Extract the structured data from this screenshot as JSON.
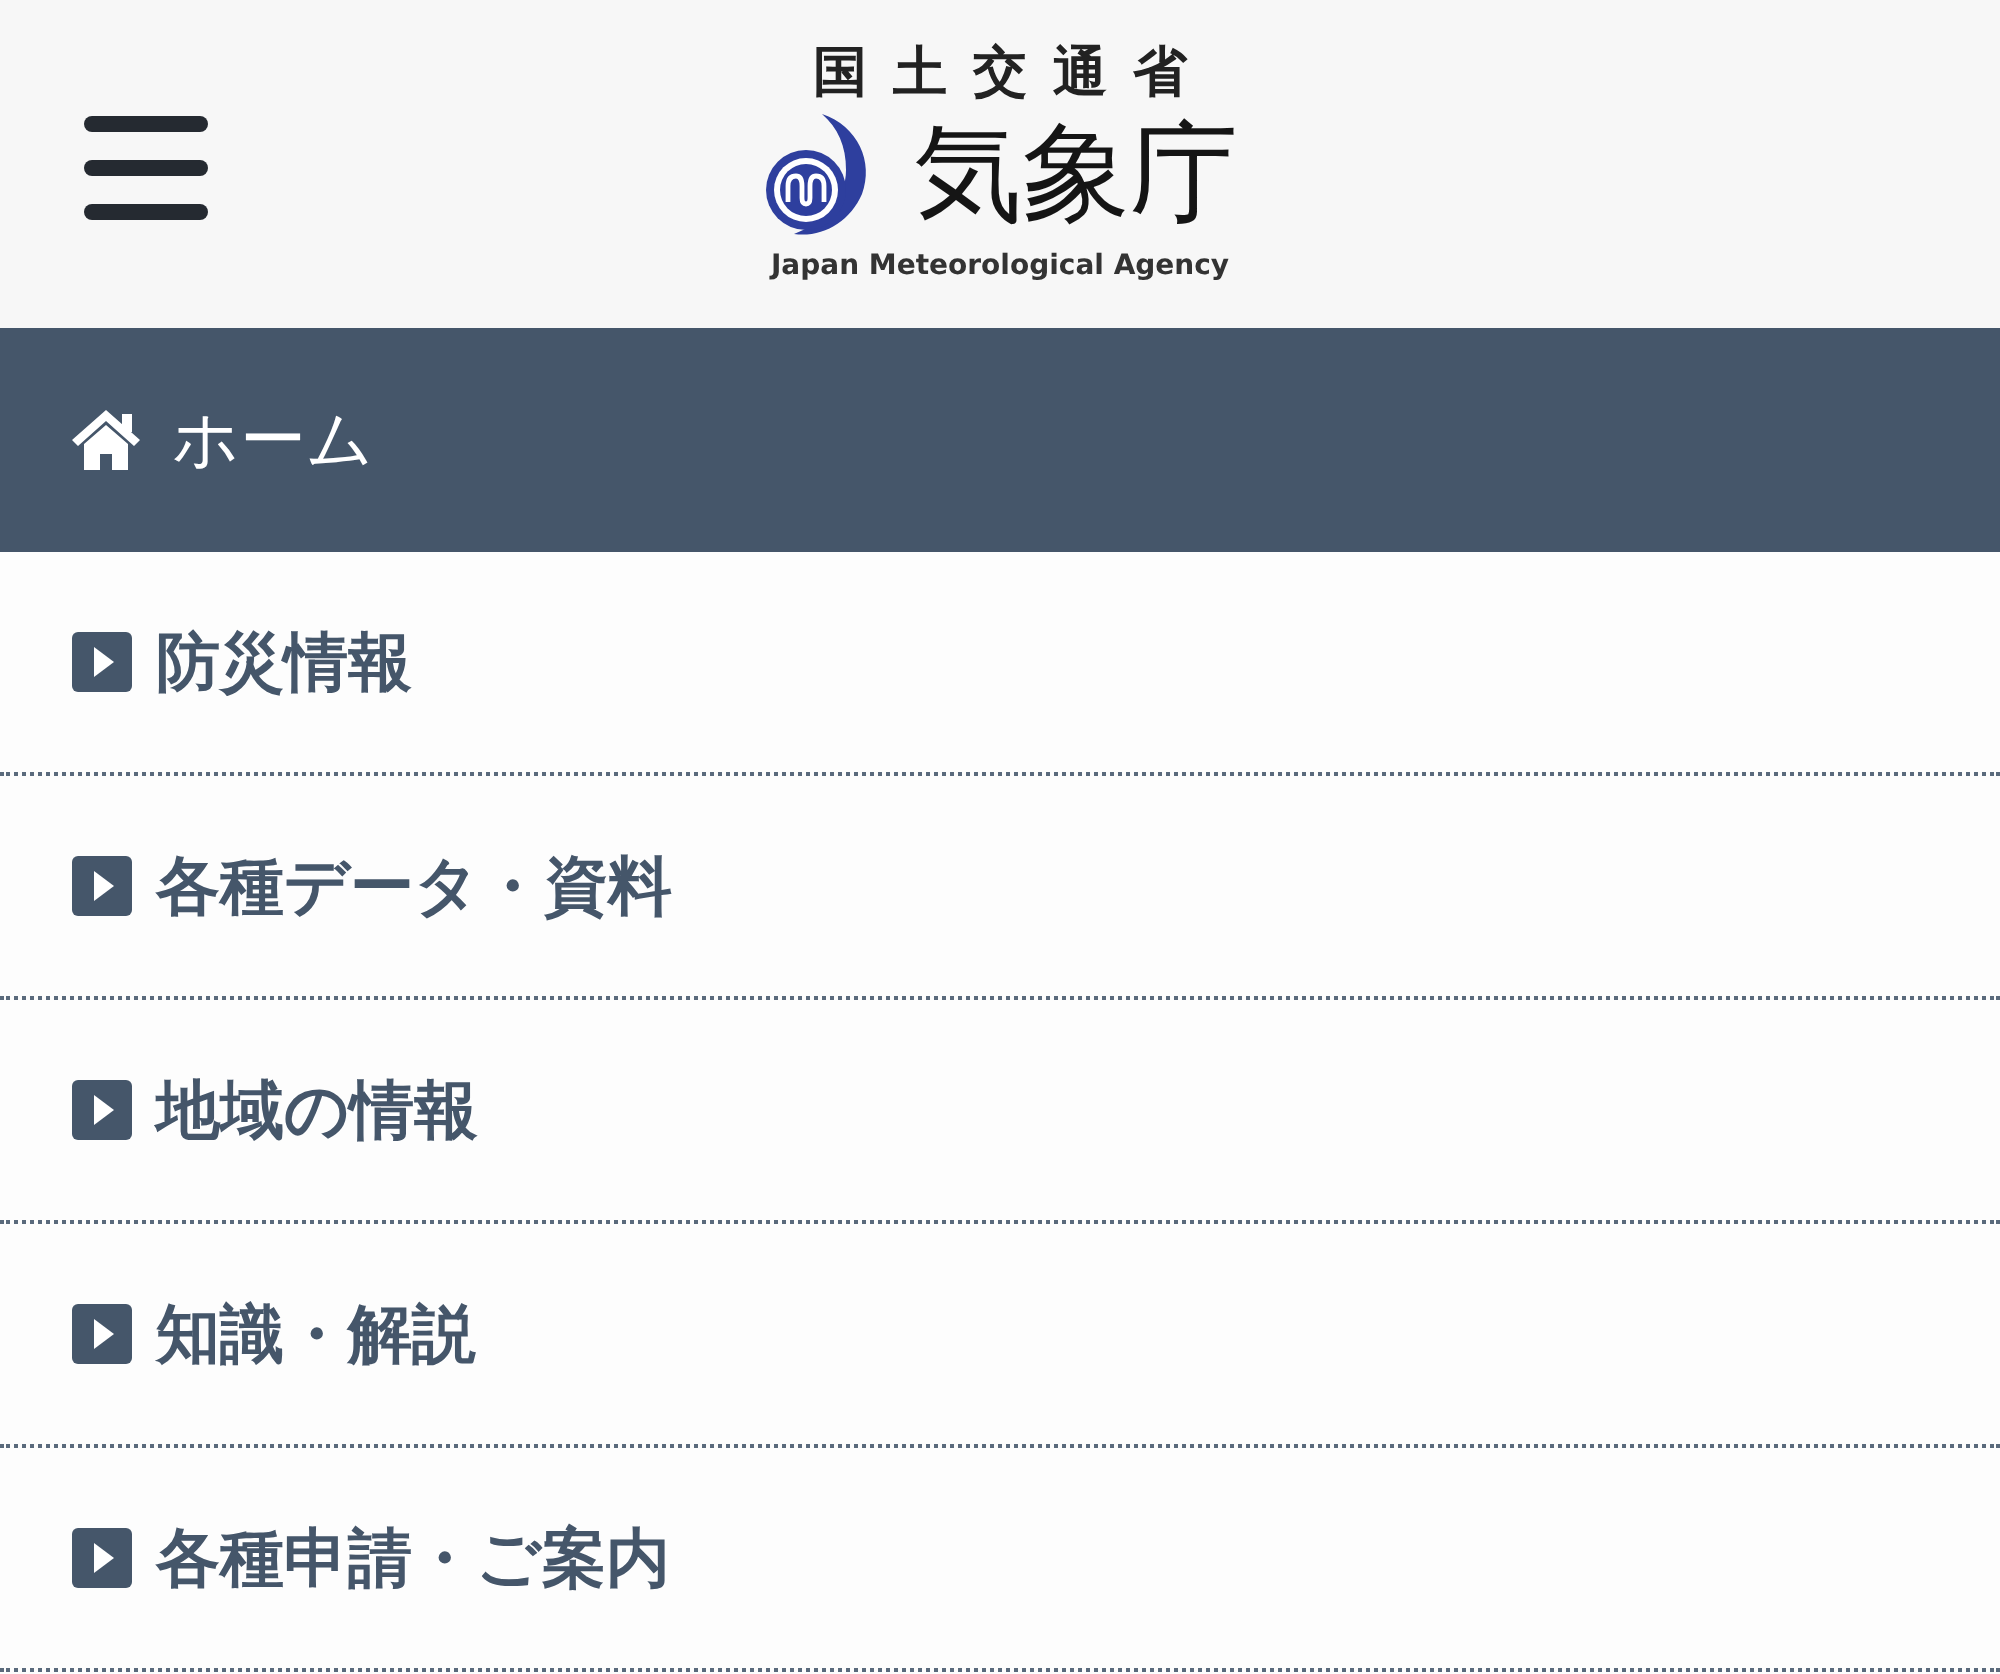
{
  "header": {
    "ministry": "国土交通省",
    "agency": "気象庁",
    "agency_en": "Japan Meteorological Agency"
  },
  "home": {
    "label": "ホーム"
  },
  "menu": [
    {
      "label": "防災情報"
    },
    {
      "label": "各種データ・資料"
    },
    {
      "label": "地域の情報"
    },
    {
      "label": "知識・解説"
    },
    {
      "label": "各種申請・ご案内"
    }
  ]
}
